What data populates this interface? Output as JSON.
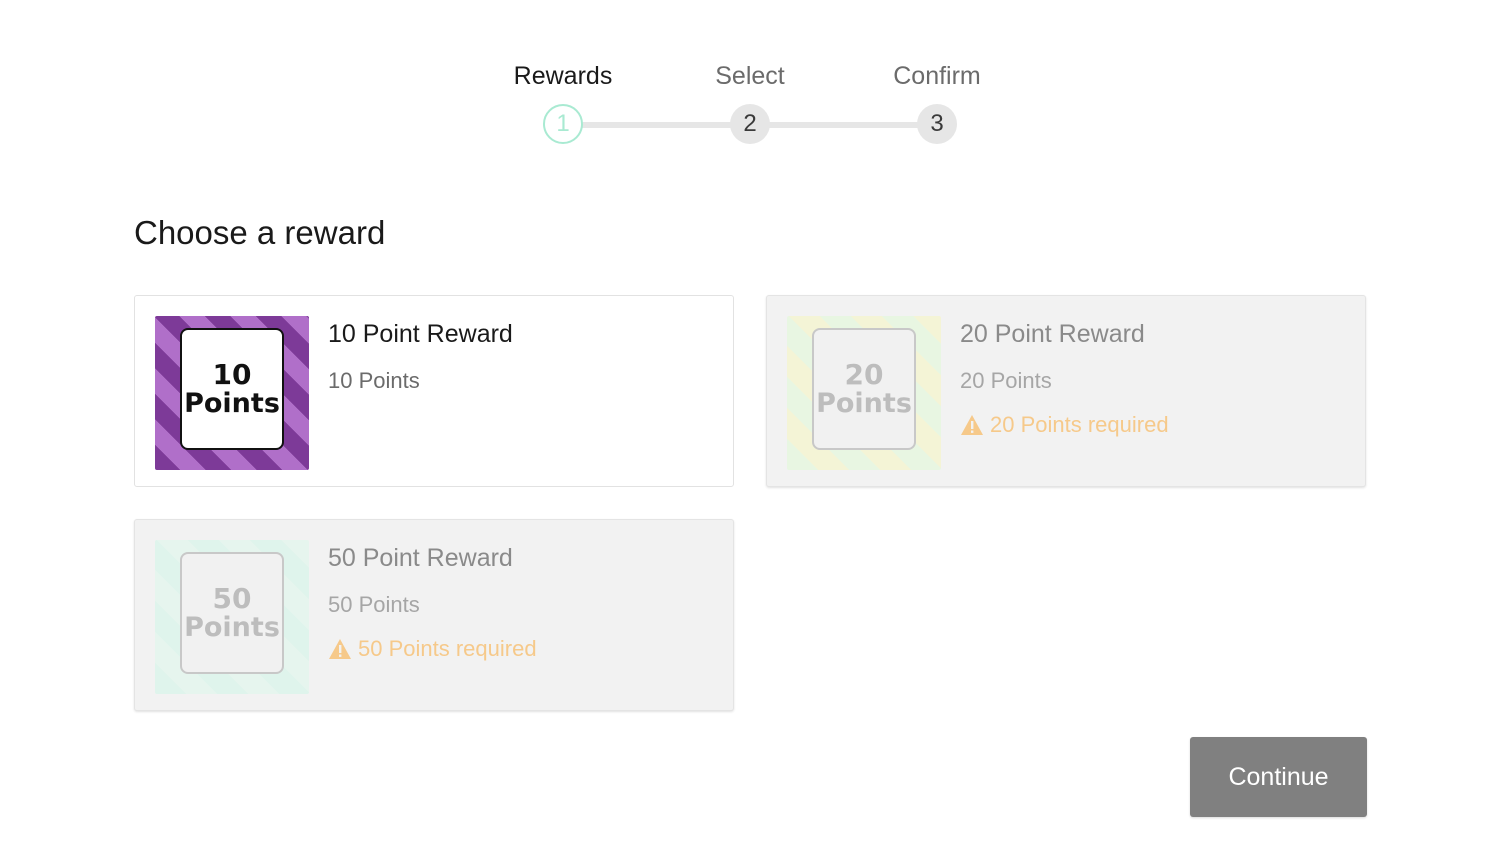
{
  "stepper": {
    "steps": [
      {
        "label": "Rewards",
        "number": "1"
      },
      {
        "label": "Select",
        "number": "2"
      },
      {
        "label": "Confirm",
        "number": "3"
      }
    ],
    "active_step": 1
  },
  "heading": "Choose a reward",
  "rewards": [
    {
      "title": "10 Point Reward",
      "points": "10 Points",
      "badge_number": "10",
      "badge_unit": "Points",
      "available": true,
      "warning": ""
    },
    {
      "title": "20 Point Reward",
      "points": "20 Points",
      "badge_number": "20",
      "badge_unit": "Points",
      "available": false,
      "warning": "20 Points required"
    },
    {
      "title": "50 Point Reward",
      "points": "50 Points",
      "badge_number": "50",
      "badge_unit": "Points",
      "available": false,
      "warning": "50 Points required"
    }
  ],
  "continue_label": "Continue",
  "colors": {
    "active_step_accent": "#a9ead2",
    "warning": "#f6c98a",
    "reward_purple": "#7d3a98",
    "button_bg": "#808080"
  },
  "icons": {
    "warning": "warning-triangle-icon"
  }
}
